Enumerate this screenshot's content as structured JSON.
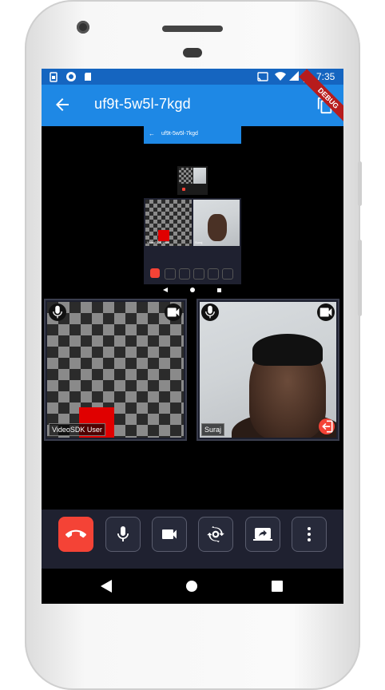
{
  "status_bar": {
    "time": "7:35"
  },
  "app_bar": {
    "title": "uf9t-5w5l-7kgd",
    "debug_banner": "DEBUG"
  },
  "mini_preview": {
    "title": "uf9t-5w5l-7kgd",
    "label_a": "VideoSDK User",
    "label_b": "Suraj"
  },
  "participants": [
    {
      "name": "VideoSDK User"
    },
    {
      "name": "Suraj"
    }
  ],
  "controls": [
    {
      "name": "leave",
      "icon": "phone-hangup-icon"
    },
    {
      "name": "mic",
      "icon": "mic-icon"
    },
    {
      "name": "camera",
      "icon": "videocam-icon"
    },
    {
      "name": "switch-camera",
      "icon": "switch-camera-icon"
    },
    {
      "name": "screen-share",
      "icon": "screen-share-icon"
    },
    {
      "name": "more",
      "icon": "more-vert-icon"
    }
  ],
  "colors": {
    "app_bar": "#1e88e5",
    "status_bar": "#1565c0",
    "leave": "#f44336",
    "controls_bg": "#1f2130"
  }
}
